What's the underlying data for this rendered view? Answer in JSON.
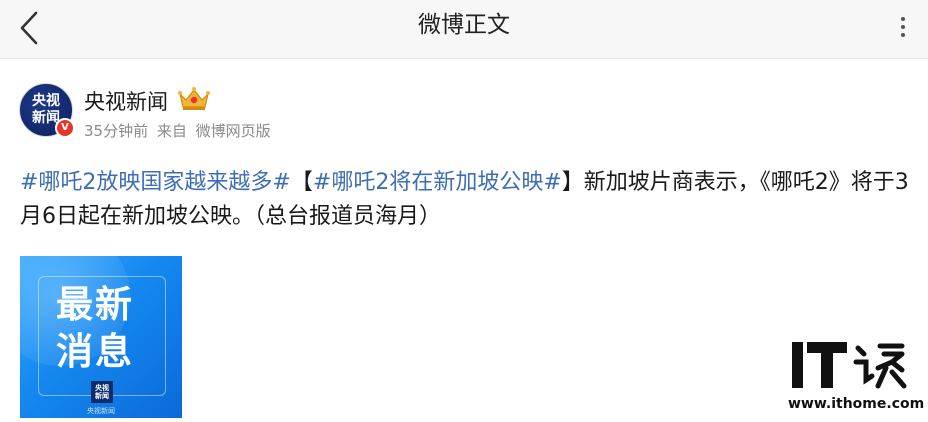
{
  "nav": {
    "title": "微博正文"
  },
  "author": {
    "avatar_line1": "央视",
    "avatar_line2": "新闻",
    "verified_badge": "V",
    "name": "央视新闻",
    "time": "35分钟前",
    "source_prefix": "来自",
    "source": "微博网页版"
  },
  "post": {
    "tag1": "#哪吒2放映国家越来越多#",
    "bracket_open": "【",
    "tag2": "#哪吒2将在新加坡公映#",
    "bracket_close": "】",
    "body": "新加坡片商表示，《哪吒2》将于3月6日起在新加坡公映。（总台报道员海月）"
  },
  "image_card": {
    "line1": "最新",
    "line2": "消息",
    "logo_line1": "央视",
    "logo_line2": "新闻",
    "caption": "央视新闻"
  },
  "watermark": {
    "url": "www.ithome.com"
  },
  "colors": {
    "link": "#3d6eb5",
    "card_blue": "#1588f0",
    "verified": "#e8352b",
    "meta_gray": "#8a8a8a"
  },
  "icons": [
    "chevron-left-icon",
    "more-vertical-icon",
    "crown-badge-icon",
    "verified-icon"
  ]
}
